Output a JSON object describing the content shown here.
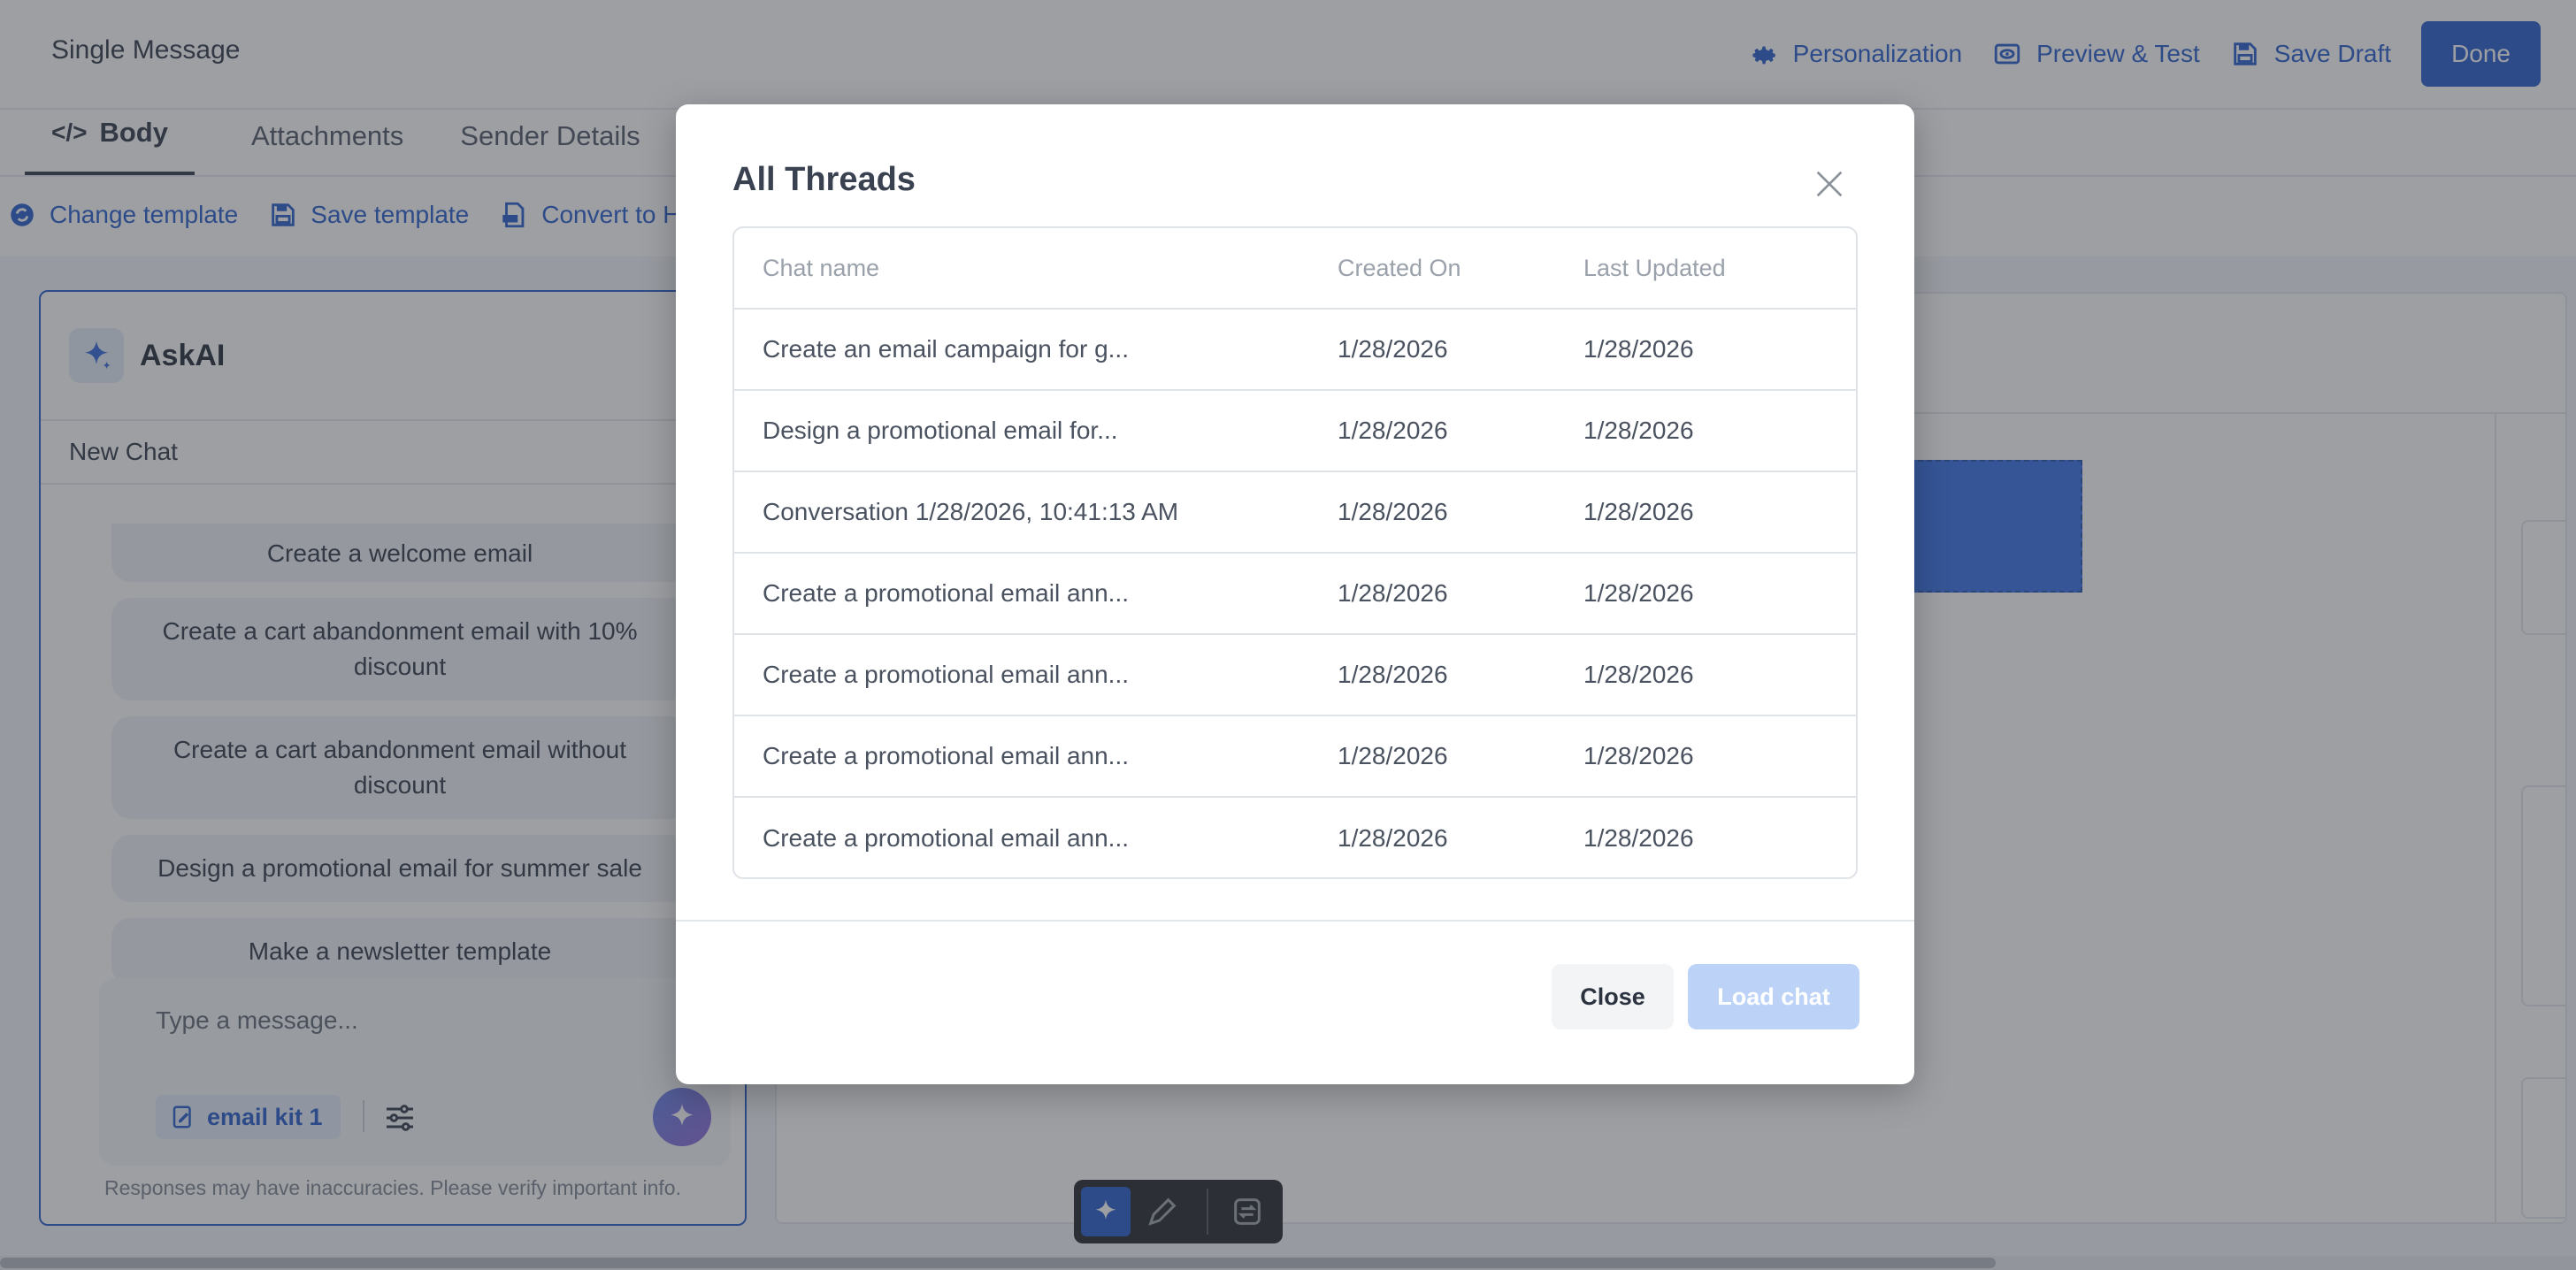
{
  "header": {
    "title": "Single Message",
    "actions": {
      "personalization": "Personalization",
      "preview": "Preview & Test",
      "save_draft": "Save Draft",
      "done": "Done"
    }
  },
  "tabs": {
    "body": "Body",
    "attachments": "Attachments",
    "sender": "Sender Details"
  },
  "toolbar": {
    "change_template": "Change template",
    "save_template": "Save template",
    "convert": "Convert to H"
  },
  "askai": {
    "title": "AskAI",
    "new_chat": "New Chat",
    "suggestions": [
      "Create a welcome email",
      "Create a cart abandonment email with 10% discount",
      "Create a cart abandonment email without discount",
      "Design a promotional email for summer sale",
      "Make a newsletter template"
    ],
    "input_placeholder": "Type a message...",
    "kit_label": "email kit 1",
    "disclaimer": "Responses may have inaccuracies. Please verify important info."
  },
  "modal": {
    "title": "All Threads",
    "columns": [
      "Chat name",
      "Created On",
      "Last Updated"
    ],
    "rows": [
      {
        "name": "Create an email campaign for g...",
        "created": "1/28/2026",
        "updated": "1/28/2026"
      },
      {
        "name": "Design a promotional email for...",
        "created": "1/28/2026",
        "updated": "1/28/2026"
      },
      {
        "name": "Conversation 1/28/2026, 10:41:13 AM",
        "created": "1/28/2026",
        "updated": "1/28/2026"
      },
      {
        "name": "Create a promotional email ann...",
        "created": "1/28/2026",
        "updated": "1/28/2026"
      },
      {
        "name": "Create a promotional email ann...",
        "created": "1/28/2026",
        "updated": "1/28/2026"
      },
      {
        "name": "Create a promotional email ann...",
        "created": "1/28/2026",
        "updated": "1/28/2026"
      },
      {
        "name": "Create a promotional email ann...",
        "created": "1/28/2026",
        "updated": "1/28/2026"
      }
    ],
    "close_label": "Close",
    "load_label": "Load chat"
  },
  "colors": {
    "accent": "#1f56c9",
    "overlay": "#3c4048",
    "load_disabled": "#bcd3f7"
  }
}
